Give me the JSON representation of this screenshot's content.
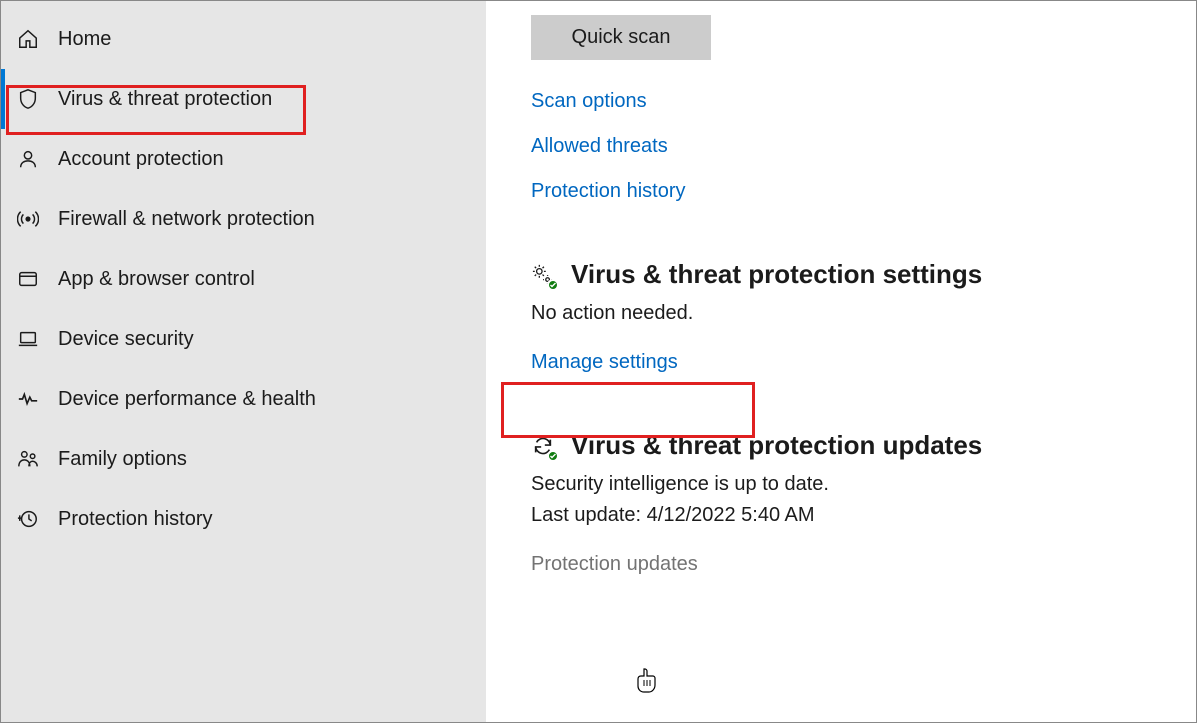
{
  "sidebar": {
    "items": [
      {
        "label": "Home"
      },
      {
        "label": "Virus & threat protection"
      },
      {
        "label": "Account protection"
      },
      {
        "label": "Firewall & network protection"
      },
      {
        "label": "App & browser control"
      },
      {
        "label": "Device security"
      },
      {
        "label": "Device performance & health"
      },
      {
        "label": "Family options"
      },
      {
        "label": "Protection history"
      }
    ]
  },
  "content": {
    "quick_scan_label": "Quick scan",
    "links": {
      "scan_options": "Scan options",
      "allowed_threats": "Allowed threats",
      "protection_history": "Protection history"
    },
    "settings_section": {
      "title": "Virus & threat protection settings",
      "subtitle": "No action needed.",
      "link": "Manage settings"
    },
    "updates_section": {
      "title": "Virus & threat protection updates",
      "subtitle": "Security intelligence is up to date.",
      "last_update": "Last update: 4/12/2022 5:40 AM",
      "link": "Protection updates"
    }
  }
}
